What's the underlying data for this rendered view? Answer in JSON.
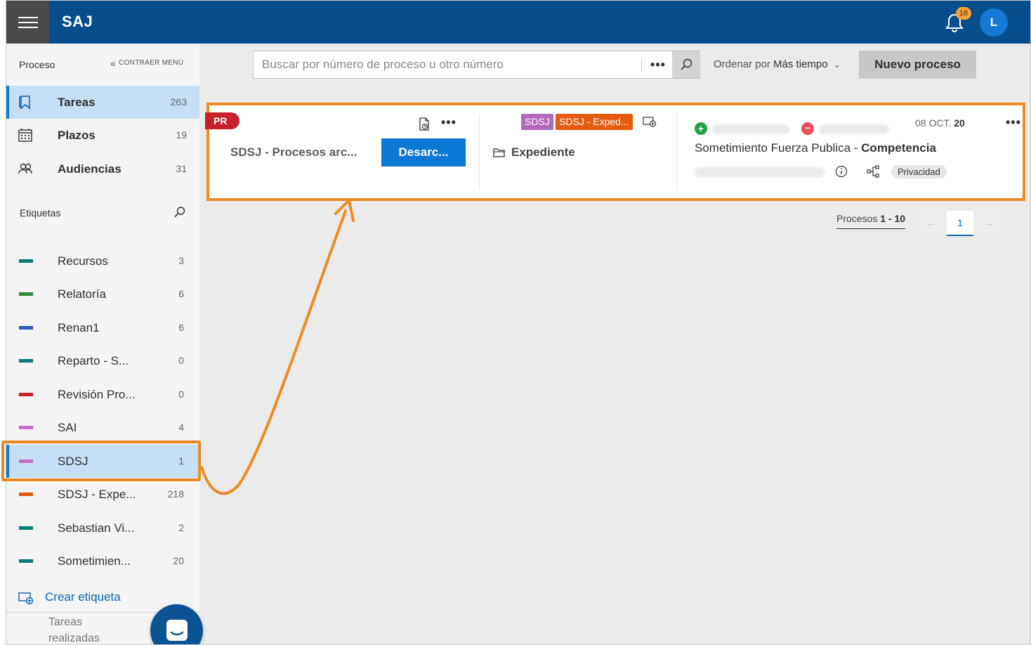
{
  "header": {
    "brand": "SAJ",
    "notifications_count": "16",
    "avatar_initial": "L"
  },
  "sidebar": {
    "title": "Proceso",
    "collapse_label": "CONTRAER MENÚ",
    "nav": [
      {
        "label": "Tareas",
        "count": "263",
        "icon": "bookmark-icon",
        "active": true
      },
      {
        "label": "Plazos",
        "count": "19",
        "icon": "calendar-icon",
        "active": false
      },
      {
        "label": "Audiencias",
        "count": "31",
        "icon": "people-icon",
        "active": false
      }
    ],
    "tags_title": "Etiquetas",
    "tags": [
      {
        "label": "Recursos",
        "count": "3",
        "color": "#077a7a"
      },
      {
        "label": "Relatoría",
        "count": "6",
        "color": "#2e8b3a"
      },
      {
        "label": "Renan1",
        "count": "6",
        "color": "#2a5ab3"
      },
      {
        "label": "Reparto - S...",
        "count": "0",
        "color": "#077a7a"
      },
      {
        "label": "Revisión Pro...",
        "count": "0",
        "color": "#c8202b"
      },
      {
        "label": "SAI",
        "count": "4",
        "color": "#c46fc9"
      },
      {
        "label": "SDSJ",
        "count": "1",
        "color": "#c46fc9",
        "active": true
      },
      {
        "label": "SDSJ - Expe...",
        "count": "218",
        "color": "#e55b0f"
      },
      {
        "label": "Sebastian Vi...",
        "count": "2",
        "color": "#077a7a"
      },
      {
        "label": "Sometimien...",
        "count": "20",
        "color": "#077a7a"
      }
    ],
    "create_tag": "Crear etiqueta",
    "done_tasks": "Tareas realizadas"
  },
  "toolbar": {
    "search_placeholder": "Buscar por número de proceso u otro número",
    "more": "•••",
    "sort_prefix": "Ordenar por",
    "sort_value": "Más tiempo",
    "new_button": "Nuevo proceso"
  },
  "card": {
    "flag": "PR",
    "more": "•••",
    "process_name": "SDSJ - Procesos arc...",
    "unarchive_button": "Desarc...",
    "chips": [
      "SDSJ",
      "SDSJ - Exped..."
    ],
    "folder_label": "Expediente",
    "date_prefix": "08 OCT.",
    "date_year": "20",
    "subject_prefix": "Sometimiento Fuerza Publica - ",
    "subject_bold": "Competencia",
    "privacy": "Privacidad",
    "colors": {
      "border": "#ed8a24",
      "flag": "#c8202b",
      "button": "#0b78d6"
    }
  },
  "pagination": {
    "prefix": "Procesos",
    "range": "1 - 10",
    "current": "1",
    "prev": "←",
    "next": "→"
  }
}
